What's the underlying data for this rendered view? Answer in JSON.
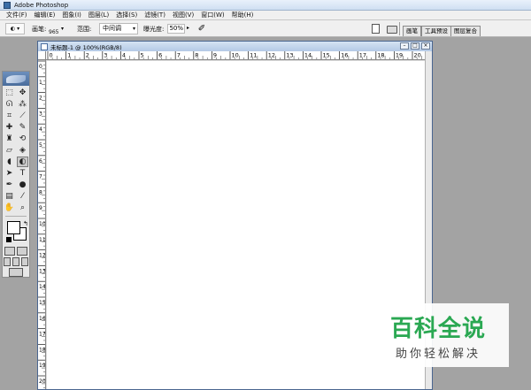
{
  "app": {
    "title": "Adobe Photoshop"
  },
  "menu": [
    "文件(F)",
    "编辑(E)",
    "图象(I)",
    "图层(L)",
    "选择(S)",
    "滤镜(T)",
    "视图(V)",
    "窗口(W)",
    "帮助(H)"
  ],
  "options": {
    "brush_label": "画笔:",
    "brush_size": "965",
    "range_label": "范围:",
    "range_value": "中间调",
    "exposure_label": "曝光度:",
    "exposure_value": "50%"
  },
  "palette_tabs": [
    "画笔",
    "工具预设",
    "图层复合"
  ],
  "document": {
    "title": "未标题-1 @ 100%(RGB/8)",
    "ruler_h": [
      "0",
      "1",
      "2",
      "3",
      "4",
      "5",
      "6",
      "7",
      "8",
      "9",
      "10",
      "11",
      "12",
      "13",
      "14",
      "15",
      "16",
      "17",
      "18",
      "19",
      "20"
    ],
    "ruler_v": [
      "0",
      "1",
      "2",
      "3",
      "4",
      "5",
      "6",
      "7",
      "8",
      "9",
      "10",
      "11",
      "12",
      "13",
      "14",
      "15",
      "16",
      "17",
      "18",
      "19",
      "20"
    ]
  },
  "tools": [
    {
      "name": "marquee-tool-icon",
      "glyph": "⬚"
    },
    {
      "name": "move-tool-icon",
      "glyph": "✥"
    },
    {
      "name": "lasso-tool-icon",
      "glyph": "ᘏ"
    },
    {
      "name": "magic-wand-tool-icon",
      "glyph": "⁂"
    },
    {
      "name": "crop-tool-icon",
      "glyph": "⌗"
    },
    {
      "name": "slice-tool-icon",
      "glyph": "⟋"
    },
    {
      "name": "healing-brush-tool-icon",
      "glyph": "✚"
    },
    {
      "name": "brush-tool-icon",
      "glyph": "✎"
    },
    {
      "name": "clone-stamp-tool-icon",
      "glyph": "♜"
    },
    {
      "name": "history-brush-tool-icon",
      "glyph": "⟲"
    },
    {
      "name": "eraser-tool-icon",
      "glyph": "▱"
    },
    {
      "name": "paint-bucket-tool-icon",
      "glyph": "◈"
    },
    {
      "name": "blur-tool-icon",
      "glyph": "◖"
    },
    {
      "name": "dodge-tool-icon",
      "glyph": "◐"
    },
    {
      "name": "path-select-tool-icon",
      "glyph": "➤"
    },
    {
      "name": "type-tool-icon",
      "glyph": "T"
    },
    {
      "name": "pen-tool-icon",
      "glyph": "✒"
    },
    {
      "name": "shape-tool-icon",
      "glyph": "●"
    },
    {
      "name": "notes-tool-icon",
      "glyph": "▤"
    },
    {
      "name": "eyedropper-tool-icon",
      "glyph": "⁄"
    },
    {
      "name": "hand-tool-icon",
      "glyph": "✋"
    },
    {
      "name": "zoom-tool-icon",
      "glyph": "⌕"
    }
  ],
  "watermark": {
    "main": "百科全说",
    "sub": "助你轻松解决"
  }
}
